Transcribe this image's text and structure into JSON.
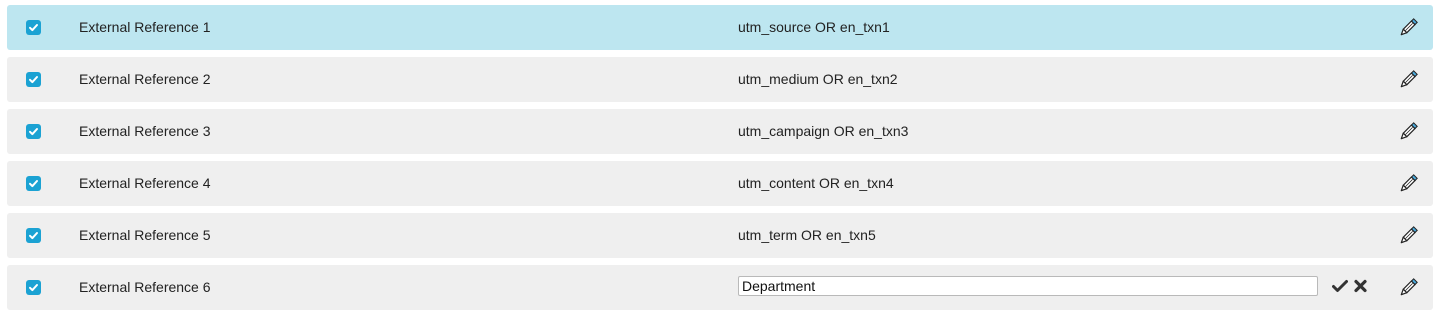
{
  "rows": [
    {
      "checked": true,
      "label": "External Reference 1",
      "mapping": "utm_source OR en_txn1",
      "highlighted": true,
      "editing": false
    },
    {
      "checked": true,
      "label": "External Reference 2",
      "mapping": "utm_medium OR en_txn2",
      "highlighted": false,
      "editing": false
    },
    {
      "checked": true,
      "label": "External Reference 3",
      "mapping": "utm_campaign OR en_txn3",
      "highlighted": false,
      "editing": false
    },
    {
      "checked": true,
      "label": "External Reference 4",
      "mapping": "utm_content OR en_txn4",
      "highlighted": false,
      "editing": false
    },
    {
      "checked": true,
      "label": "External Reference 5",
      "mapping": "utm_term OR en_txn5",
      "highlighted": false,
      "editing": false
    },
    {
      "checked": true,
      "label": "External Reference 6",
      "editing": true,
      "input_value": "Department",
      "highlighted": false
    }
  ],
  "icons": {
    "checkbox": "checkbox-checked-icon",
    "edit": "pencil-icon",
    "confirm": "checkmark-icon",
    "cancel": "close-icon"
  },
  "colors": {
    "highlight_row": "#bde6f0",
    "row": "#efefef",
    "checkbox": "#1ba2d3",
    "pencil_tip": "#4aa7d8"
  }
}
